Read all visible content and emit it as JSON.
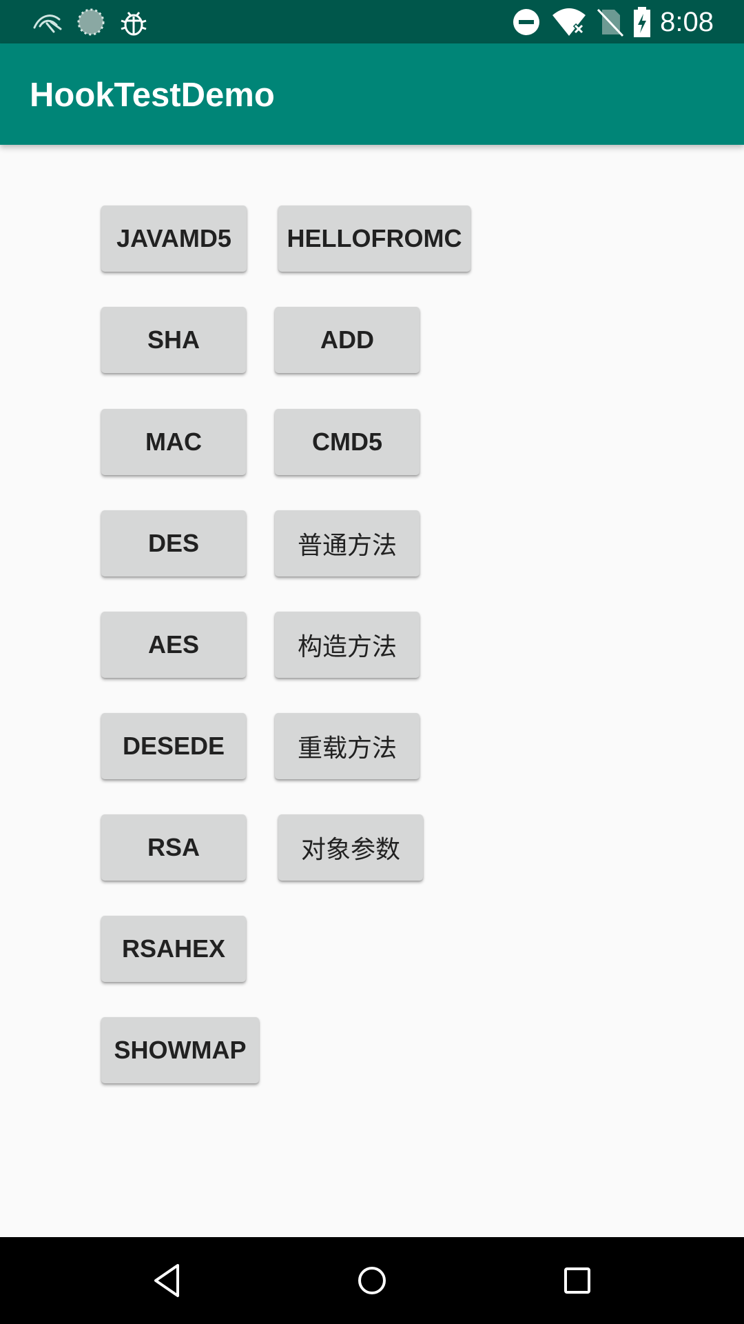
{
  "status_bar": {
    "time": "8:08",
    "left_icons": [
      "kali-dragon-icon",
      "loading-circle-icon",
      "bug-icon"
    ],
    "right_icons": [
      "do-not-disturb-icon",
      "wifi-icon",
      "no-sim-icon",
      "battery-charging-icon"
    ],
    "background": "#00574b"
  },
  "app_bar": {
    "title": "HookTestDemo",
    "background": "#008577"
  },
  "buttons": {
    "javamd5": "JAVAMD5",
    "hellofromc": "HELLOFROMC",
    "sha": "SHA",
    "add": "ADD",
    "mac": "MAC",
    "cmd5": "CMD5",
    "des": "DES",
    "normal_method": "普通方法",
    "aes": "AES",
    "constructor_method": "构造方法",
    "desede": "DESEDE",
    "overload_method": "重载方法",
    "rsa": "RSA",
    "object_param": "对象参数",
    "rsahex": "RSAHEX",
    "showmap": "SHOWMAP"
  },
  "nav_bar": {
    "icons": [
      "back-icon",
      "home-icon",
      "recents-icon"
    ],
    "background": "#000000"
  }
}
